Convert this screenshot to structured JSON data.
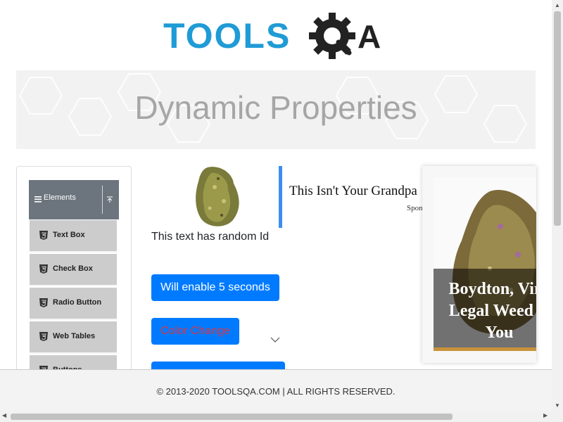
{
  "logo": {
    "text_left": "TOOLS",
    "text_right": "QA",
    "colors": {
      "blue": "#1f9bd6",
      "dark": "#222222"
    }
  },
  "header": {
    "title": "Dynamic Properties"
  },
  "sidebar": {
    "group": {
      "label": "Elements",
      "icon": "menu-icon",
      "toggle_icon": "collapse-up-icon"
    },
    "items": [
      {
        "label": "Text Box",
        "icon": "html5-icon"
      },
      {
        "label": "Check Box",
        "icon": "html5-icon"
      },
      {
        "label": "Radio Button",
        "icon": "html5-icon"
      },
      {
        "label": "Web Tables",
        "icon": "html5-icon"
      },
      {
        "label": "Buttons",
        "icon": "html5-icon"
      }
    ]
  },
  "main": {
    "random_text": "This text has random Id",
    "enable_button": "Will enable 5 seconds",
    "color_button": "Color Change",
    "visible_button": ""
  },
  "ads": {
    "ad1": {
      "headline": "This Isn't Your Grandpa",
      "sponsor": "Spon"
    },
    "ad2": {
      "text": "Boydton, Virg\nLegal Weed D\nYou"
    }
  },
  "footer": {
    "text": "© 2013-2020 TOOLSQA.COM | ALL RIGHTS RESERVED."
  },
  "colors": {
    "primary": "#007bff",
    "danger": "#dc3545",
    "sidebar_header": "#6c757d",
    "sidebar_item": "#cccccc"
  }
}
